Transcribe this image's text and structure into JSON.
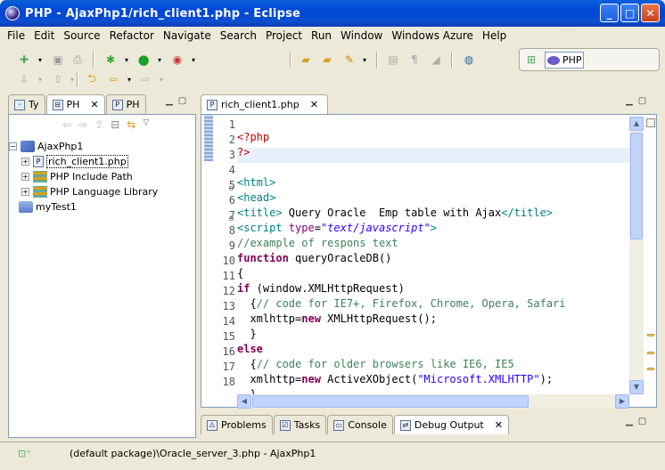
{
  "window": {
    "title": "PHP - AjaxPhp1/rich_client1.php - Eclipse"
  },
  "menu": [
    {
      "label": "File",
      "u": "F",
      "rest": "ile"
    },
    {
      "label": "Edit",
      "u": "E",
      "rest": "dit"
    },
    {
      "label": "Source",
      "u": "S",
      "rest": "ource"
    },
    {
      "label": "Refactor",
      "u": "",
      "rest": "Refactor"
    },
    {
      "label": "Navigate",
      "u": "N",
      "rest": "avigate"
    },
    {
      "label": "Search",
      "u": "S",
      "rest": "earch"
    },
    {
      "label": "Project",
      "u": "P",
      "rest": "roject"
    },
    {
      "label": "Run",
      "u": "R",
      "rest": "un"
    },
    {
      "label": "Window",
      "u": "W",
      "rest": "indow"
    },
    {
      "label": "Windows Azure",
      "u": "",
      "rest": "Windows Azure"
    },
    {
      "label": "Help",
      "u": "H",
      "rest": "elp"
    }
  ],
  "perspective": {
    "label": "PHP"
  },
  "left_tabs": [
    {
      "label": "Ty",
      "icon": "type-hierarchy-icon"
    },
    {
      "label": "PH",
      "icon": "php-explorer-icon"
    },
    {
      "label": "PH",
      "icon": "php-functions-icon"
    }
  ],
  "tree": {
    "project": "AjaxPhp1",
    "children": [
      "rich_client1.php",
      "PHP Include Path",
      "PHP Language Library"
    ],
    "other": "myTest1"
  },
  "editor": {
    "tab": "rich_client1.php",
    "line_numbers": [
      "1",
      "2",
      "3",
      "4",
      "5",
      "6",
      "7",
      "8",
      "9",
      "10",
      "11",
      "12",
      "13",
      "14",
      "15",
      "16",
      "17",
      "18"
    ]
  },
  "bottom_tabs": [
    {
      "label": "Problems",
      "icon": "problems-icon"
    },
    {
      "label": "Tasks",
      "icon": "tasks-icon"
    },
    {
      "label": "Console",
      "icon": "console-icon"
    },
    {
      "label": "Debug Output",
      "icon": "debug-output-icon"
    }
  ],
  "status": {
    "text": "(default package)\\Oracle_server_3.php - AjaxPhp1"
  },
  "colors": {
    "titlebar": "#0A5FD8",
    "keyword": "#7f0055",
    "tag": "#008080",
    "string": "#2a00ff",
    "comment": "#3f7f5f",
    "php_tag": "#c00000"
  }
}
